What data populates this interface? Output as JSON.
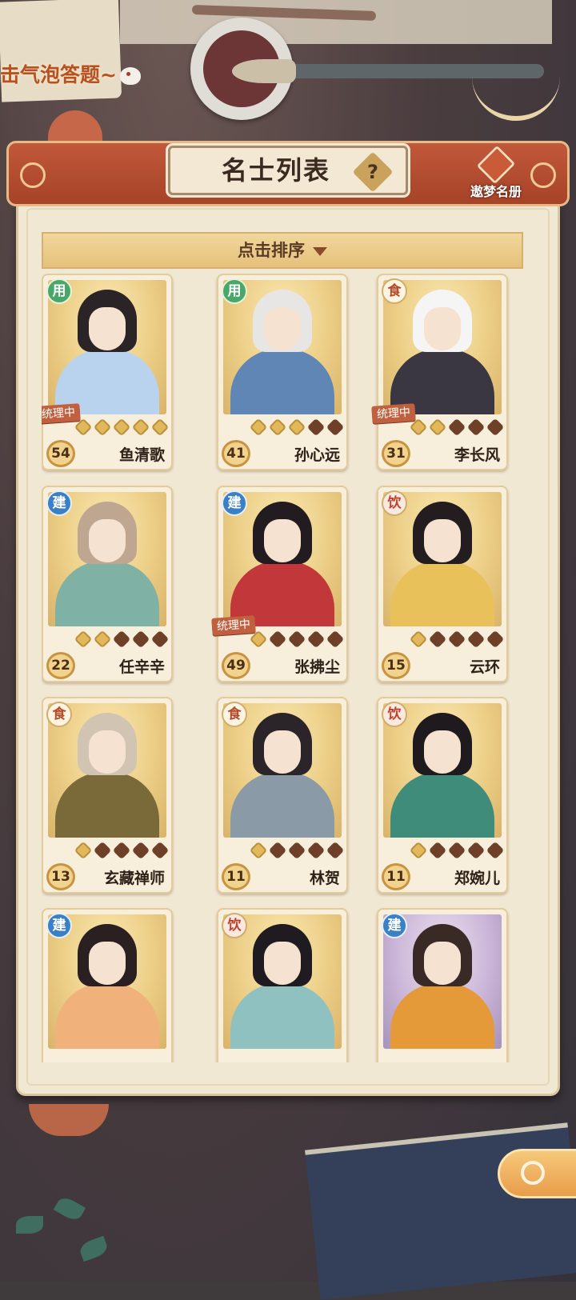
{
  "hint": "击气泡答题~",
  "header": {
    "title": "名士列表",
    "help_label": "?",
    "roster_label": "遨梦名册"
  },
  "sort": {
    "label": "点击排序"
  },
  "manage_tag": "统理中",
  "cards": [
    {
      "name": "鱼清歌",
      "level": "54",
      "type": "用",
      "stars": 5,
      "managing": true,
      "hair": "#2b2426",
      "robe": "#b9d3ef"
    },
    {
      "name": "孙心远",
      "level": "41",
      "type": "用",
      "stars": 3,
      "managing": false,
      "hair": "#e7e6e4",
      "robe": "#5f86b5"
    },
    {
      "name": "李长风",
      "level": "31",
      "type": "食",
      "stars": 2,
      "managing": true,
      "hair": "#f5f5f5",
      "robe": "#3a3642"
    },
    {
      "name": "任辛辛",
      "level": "22",
      "type": "建",
      "stars": 2,
      "managing": false,
      "hair": "#bfa691",
      "robe": "#7fb2a4"
    },
    {
      "name": "张拂尘",
      "level": "49",
      "type": "建",
      "stars": 1,
      "managing": true,
      "hair": "#221c20",
      "robe": "#c2383a"
    },
    {
      "name": "云环",
      "level": "15",
      "type": "饮",
      "stars": 1,
      "managing": false,
      "hair": "#231d20",
      "robe": "#e8c15a"
    },
    {
      "name": "玄藏禅师",
      "level": "13",
      "type": "食",
      "stars": 1,
      "managing": false,
      "hair": "#d2c4b3",
      "robe": "#7a6a3a"
    },
    {
      "name": "林贺",
      "level": "11",
      "type": "食",
      "stars": 1,
      "managing": false,
      "hair": "#2b2428",
      "robe": "#8a9aa6"
    },
    {
      "name": "郑婉儿",
      "level": "11",
      "type": "饮",
      "stars": 1,
      "managing": false,
      "hair": "#1f1a1d",
      "robe": "#3f8c7a"
    },
    {
      "name": "",
      "level": "",
      "type": "建",
      "stars": 0,
      "managing": false,
      "hair": "#2a2022",
      "robe": "#f0b27a"
    },
    {
      "name": "",
      "level": "",
      "type": "饮",
      "stars": 0,
      "managing": false,
      "hair": "#1f1b20",
      "robe": "#8fc1c0"
    },
    {
      "name": "",
      "level": "",
      "type": "建",
      "stars": 0,
      "managing": false,
      "hair": "#3a2a26",
      "robe": "#e59a3a",
      "purple": true
    }
  ],
  "type_classes": {
    "用": "t-use",
    "食": "t-food",
    "建": "t-build",
    "饮": "t-drink"
  }
}
